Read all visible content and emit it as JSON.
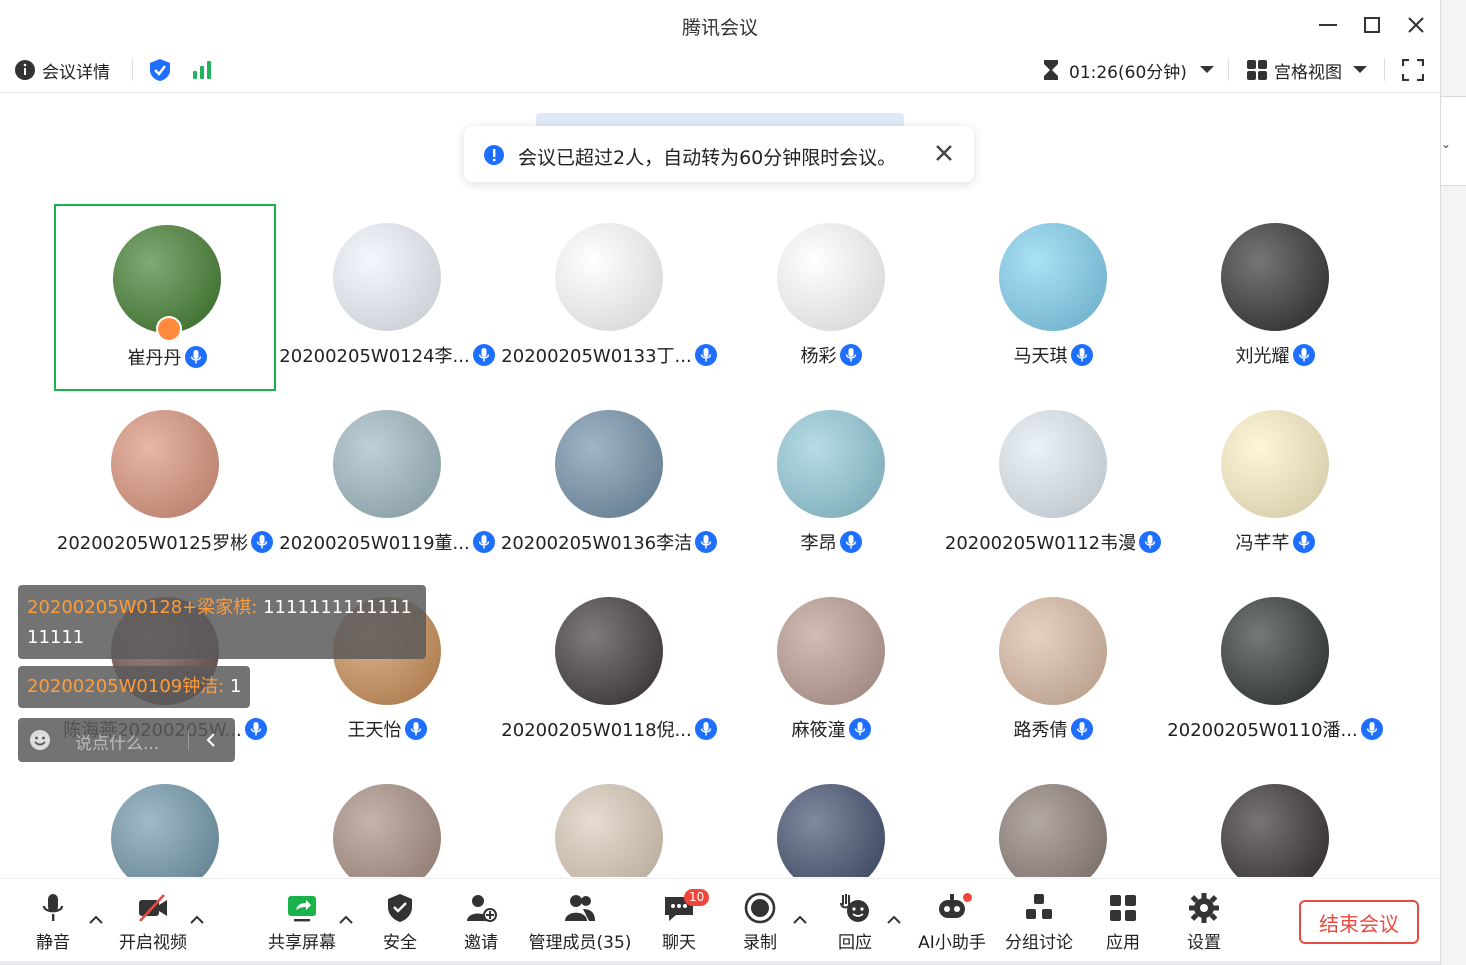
{
  "window": {
    "title": "腾讯会议"
  },
  "toolbar": {
    "details_label": "会议详情",
    "timer": "01:26(60分钟)",
    "view_label": "宫格视图"
  },
  "toast": {
    "text": "会议已超过2人，自动转为60分钟限时会议。"
  },
  "participants": [
    {
      "name": "崔丹丹",
      "host": true,
      "active": true,
      "avatar_color": "#3d7a2a"
    },
    {
      "name": "20200205W0124李...",
      "avatar_color": "#eef3fb"
    },
    {
      "name": "20200205W0133丁...",
      "avatar_color": "#ffffff"
    },
    {
      "name": "杨彩",
      "avatar_color": "#ffffff"
    },
    {
      "name": "马天琪",
      "avatar_color": "#7dd0f0"
    },
    {
      "name": "刘光耀",
      "avatar_color": "#2e2b2c"
    },
    {
      "name": "20200205W0125罗彬",
      "avatar_color": "#d99078"
    },
    {
      "name": "20200205W0119董...",
      "avatar_color": "#9cb7c0"
    },
    {
      "name": "20200205W0136李洁",
      "avatar_color": "#6f8ea8"
    },
    {
      "name": "李昂",
      "avatar_color": "#8fc9d9"
    },
    {
      "name": "20200205W0112韦漫",
      "avatar_color": "#dfeaf2"
    },
    {
      "name": "冯芊芊",
      "avatar_color": "#fdf1c6"
    },
    {
      "name": "陈海燕20200205W...",
      "avatar_color": "#6b4a44"
    },
    {
      "name": "王天怡",
      "avatar_color": "#c98b52"
    },
    {
      "name": "20200205W0118倪...",
      "avatar_color": "#3b3335"
    },
    {
      "name": "麻筱潼",
      "avatar_color": "#b89a8f"
    },
    {
      "name": "路秀倩",
      "avatar_color": "#d9b9a1"
    },
    {
      "name": "20200205W0110潘...",
      "avatar_color": "#2c3031"
    },
    {
      "name": "",
      "avatar_color": "#6d94a8"
    },
    {
      "name": "",
      "avatar_color": "#a58c80"
    },
    {
      "name": "",
      "avatar_color": "#d8c9b6"
    },
    {
      "name": "",
      "avatar_color": "#3c4a6a"
    },
    {
      "name": "",
      "avatar_color": "#8a7a72"
    },
    {
      "name": "",
      "avatar_color": "#2f2a29"
    }
  ],
  "chat": {
    "messages": [
      {
        "sender": "20200205W0128+梁家棋: ",
        "text": "111111111111111111"
      },
      {
        "sender": "20200205W0109钟洁: ",
        "text": "1"
      }
    ],
    "placeholder": "说点什么..."
  },
  "bottom": {
    "mute": "静音",
    "video": "开启视频",
    "share": "共享屏幕",
    "security": "安全",
    "invite": "邀请",
    "members": "管理成员(35)",
    "chat": "聊天",
    "chat_badge": "10",
    "record": "录制",
    "react": "回应",
    "ai": "AI小助手",
    "breakout": "分组讨论",
    "apps": "应用",
    "settings": "设置",
    "end": "结束会议"
  },
  "colors": {
    "accent": "#1e6fff",
    "active_border": "#19b24b",
    "end": "#e84b43",
    "signal": "#1fb35b"
  }
}
